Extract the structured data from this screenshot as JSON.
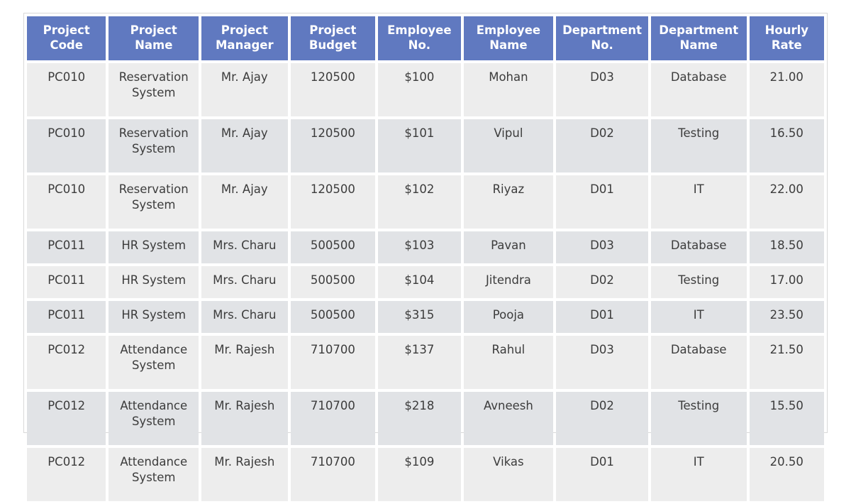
{
  "table": {
    "columns": [
      {
        "line1": "Project",
        "line2": "Code"
      },
      {
        "line1": "Project",
        "line2": "Name"
      },
      {
        "line1": "Project",
        "line2": "Manager"
      },
      {
        "line1": "Project",
        "line2": "Budget"
      },
      {
        "line1": "Employee",
        "line2": "No."
      },
      {
        "line1": "Employee",
        "line2": "Name"
      },
      {
        "line1": "Department",
        "line2": "No."
      },
      {
        "line1": "Department",
        "line2": "Name"
      },
      {
        "line1": "Hourly",
        "line2": "Rate"
      }
    ],
    "rows": [
      {
        "project_code": "PC010",
        "project_name": "Reservation System",
        "project_manager": "Mr. Ajay",
        "project_budget": "120500",
        "employee_no": "$100",
        "employee_name": "Mohan",
        "department_no": "D03",
        "department_name": "Database",
        "hourly_rate": "21.00"
      },
      {
        "project_code": "PC010",
        "project_name": "Reservation System",
        "project_manager": "Mr. Ajay",
        "project_budget": "120500",
        "employee_no": "$101",
        "employee_name": "Vipul",
        "department_no": "D02",
        "department_name": "Testing",
        "hourly_rate": "16.50"
      },
      {
        "project_code": "PC010",
        "project_name": "Reservation System",
        "project_manager": "Mr. Ajay",
        "project_budget": "120500",
        "employee_no": "$102",
        "employee_name": "Riyaz",
        "department_no": "D01",
        "department_name": "IT",
        "hourly_rate": "22.00"
      },
      {
        "project_code": "PC011",
        "project_name": "HR System",
        "project_manager": "Mrs. Charu",
        "project_budget": "500500",
        "employee_no": "$103",
        "employee_name": "Pavan",
        "department_no": "D03",
        "department_name": "Database",
        "hourly_rate": "18.50"
      },
      {
        "project_code": "PC011",
        "project_name": "HR System",
        "project_manager": "Mrs. Charu",
        "project_budget": "500500",
        "employee_no": "$104",
        "employee_name": "Jitendra",
        "department_no": "D02",
        "department_name": "Testing",
        "hourly_rate": "17.00"
      },
      {
        "project_code": "PC011",
        "project_name": "HR System",
        "project_manager": "Mrs. Charu",
        "project_budget": "500500",
        "employee_no": "$315",
        "employee_name": "Pooja",
        "department_no": "D01",
        "department_name": "IT",
        "hourly_rate": "23.50"
      },
      {
        "project_code": "PC012",
        "project_name": "Attendance System",
        "project_manager": "Mr. Rajesh",
        "project_budget": "710700",
        "employee_no": "$137",
        "employee_name": "Rahul",
        "department_no": "D03",
        "department_name": "Database",
        "hourly_rate": "21.50"
      },
      {
        "project_code": "PC012",
        "project_name": "Attendance System",
        "project_manager": "Mr. Rajesh",
        "project_budget": "710700",
        "employee_no": "$218",
        "employee_name": "Avneesh",
        "department_no": "D02",
        "department_name": "Testing",
        "hourly_rate": "15.50"
      },
      {
        "project_code": "PC012",
        "project_name": "Attendance System",
        "project_manager": "Mr. Rajesh",
        "project_budget": "710700",
        "employee_no": "$109",
        "employee_name": "Vikas",
        "department_no": "D01",
        "department_name": "IT",
        "hourly_rate": "20.50"
      }
    ],
    "colors": {
      "header_background": "#6079c0",
      "header_text": "#ffffff",
      "row_odd_background": "#ededed",
      "row_even_background": "#e1e3e6",
      "cell_text": "#3c3c3c",
      "frame_border": "#d8d8d8"
    }
  }
}
